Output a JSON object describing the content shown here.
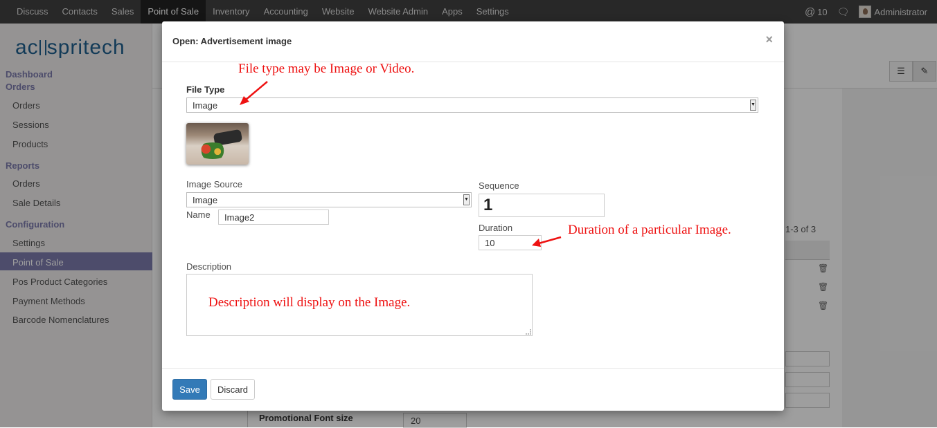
{
  "topbar": {
    "menu": [
      "Discuss",
      "Contacts",
      "Sales",
      "Point of Sale",
      "Inventory",
      "Accounting",
      "Website",
      "Website Admin",
      "Apps",
      "Settings"
    ],
    "active": "Point of Sale",
    "mentions": "10",
    "user": "Administrator",
    "icons": [
      "at-icon",
      "chat-icon",
      "avatar"
    ]
  },
  "logo": {
    "left": "ac",
    "right": "spritech"
  },
  "sidebar": {
    "sections": [
      {
        "title": "Dashboard",
        "items": []
      },
      {
        "title": "Orders",
        "items": [
          "Orders",
          "Sessions",
          "Products"
        ]
      },
      {
        "title": "Reports",
        "items": [
          "Orders",
          "Sale Details"
        ]
      },
      {
        "title": "Configuration",
        "items": [
          "Settings",
          "Point of Sale",
          "Pos Product Categories",
          "Payment Methods",
          "Barcode Nomenclatures"
        ]
      }
    ],
    "active_item": "Point of Sale"
  },
  "background": {
    "pager": "1-3 of 3",
    "promo_label": "Promotional Font size",
    "promo_value": "20"
  },
  "modal": {
    "title": "Open: Advertisement image",
    "close": "×",
    "file_type_label": "File Type",
    "file_type_value": "Image",
    "image_source_label": "Image Source",
    "image_source_value": "Image",
    "name_label": "Name",
    "name_value": "Image2",
    "sequence_label": "Sequence",
    "sequence_value": "1",
    "duration_label": "Duration",
    "duration_value": "10",
    "description_label": "Description",
    "save_label": "Save",
    "discard_label": "Discard"
  },
  "annotations": {
    "file_type": "File type may be Image or Video.",
    "duration": "Duration of a particular Image.",
    "description": "Description will display on the Image.",
    "color": "#e11111"
  }
}
